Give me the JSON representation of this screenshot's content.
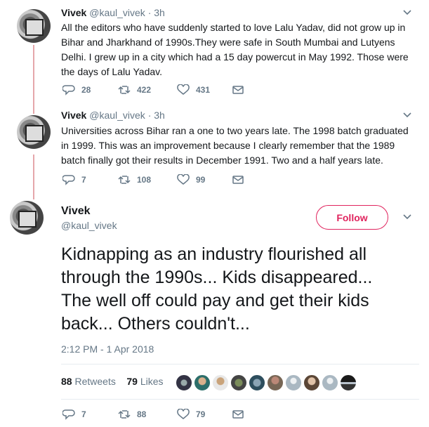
{
  "tweets": [
    {
      "name": "Vivek",
      "handle": "@kaul_vivek",
      "dot": "·",
      "time": "3h",
      "lines": [
        "All the editors who have suddenly started to love Lalu Yadav, did not grow up in",
        "Bihar and Jharkhand of 1990s.They were safe in South Mumbai and Lutyens",
        "Delhi. I grew up in a city which had a 15 day powercut in May 1992. Those were",
        "the days of Lalu Yadav."
      ],
      "replies": "28",
      "retweets": "422",
      "likes": "431"
    },
    {
      "name": "Vivek",
      "handle": "@kaul_vivek",
      "dot": "·",
      "time": "3h",
      "lines": [
        "Universities across Bihar ran a one to two years late. The 1998 batch graduated",
        "in 1999. This was an improvement because I clearly remember that the 1989",
        "batch finally got their results in December 1991. Two and a half years late."
      ],
      "replies": "7",
      "retweets": "108",
      "likes": "99"
    }
  ],
  "main": {
    "name": "Vivek",
    "handle": "@kaul_vivek",
    "follow_label": "Follow",
    "lines": [
      "Kidnapping as an industry flourished all",
      "through the 1990s... Kids disappeared...",
      "The well off could pay and get their kids",
      "back... Others couldn't..."
    ],
    "timestamp": "2:12 PM - 1 Apr 2018",
    "retweet_count": "88",
    "retweet_label": "Retweets",
    "like_count": "79",
    "like_label": "Likes",
    "replies": "7",
    "retweets": "88",
    "likes": "79"
  },
  "colors": {
    "follow_accent": "#e0245e",
    "thread_line": "#e5a7ab",
    "secondary_text": "#657786"
  },
  "icons": [
    "reply-icon",
    "retweet-icon",
    "like-icon",
    "direct-message-icon",
    "chevron-down-icon"
  ]
}
